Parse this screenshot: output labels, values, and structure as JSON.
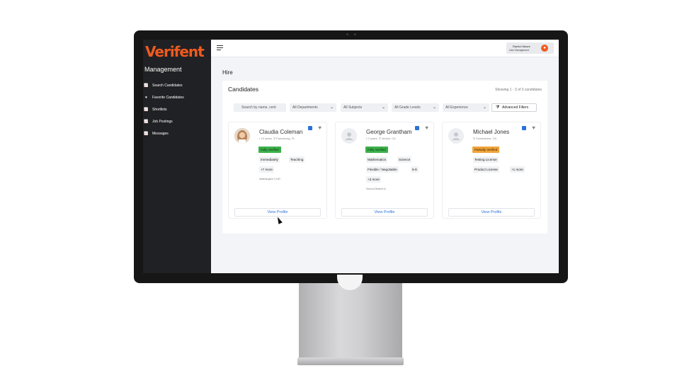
{
  "app": {
    "logo": "Verifent",
    "section": "Management"
  },
  "sidebar": {
    "items": [
      {
        "label": "Search Candidates",
        "icon": "chart-icon"
      },
      {
        "label": "Favorite Candidates",
        "icon": "heart-icon"
      },
      {
        "label": "Shortlists",
        "icon": "chart-icon"
      },
      {
        "label": "Job Postings",
        "icon": "chart-icon"
      },
      {
        "label": "Messages",
        "icon": "chart-icon"
      }
    ]
  },
  "topbar": {
    "user_name": "Rachel Moore",
    "user_role": "User Management"
  },
  "page": {
    "title": "Hire"
  },
  "panel": {
    "title": "Candidates",
    "showing": "Showing 1 - 3 of 3 candidates"
  },
  "filters": {
    "search_placeholder": "Search by name, certi",
    "departments": "All Departments",
    "subjects": "All Subjects",
    "grade_levels": "All Grade Levels",
    "experience": "All Experience",
    "advanced": "Advanced Filters"
  },
  "candidates": [
    {
      "name": "Claudia Coleman",
      "years": "10 years",
      "location": "Farmsburg, FL",
      "status": "Fully Verified",
      "tags": [
        "Immediately",
        "Teaching",
        "+7 more"
      ],
      "district": "Washington T-HD",
      "view": "View Profile"
    },
    {
      "name": "George Grantham",
      "years": "2 years",
      "location": "Venice, CA",
      "status": "Fully Verified",
      "tags": [
        "Mathematics",
        "Science",
        "Flexible / Negotiable",
        "6-8",
        "+3 more"
      ],
      "district": "School District A",
      "view": "View Profile"
    },
    {
      "name": "Michael Jones",
      "years": "",
      "location": "Somewhere, CA",
      "status": "Partially Verified",
      "tags": [
        "Testing License",
        "Product License",
        "+1 more"
      ],
      "district": "",
      "view": "View Profile"
    }
  ],
  "colors": {
    "accent": "#f05a1f",
    "link": "#2b72d8",
    "verified": "#3cb04b",
    "partial": "#f0a43a",
    "sidebar": "#202124"
  }
}
